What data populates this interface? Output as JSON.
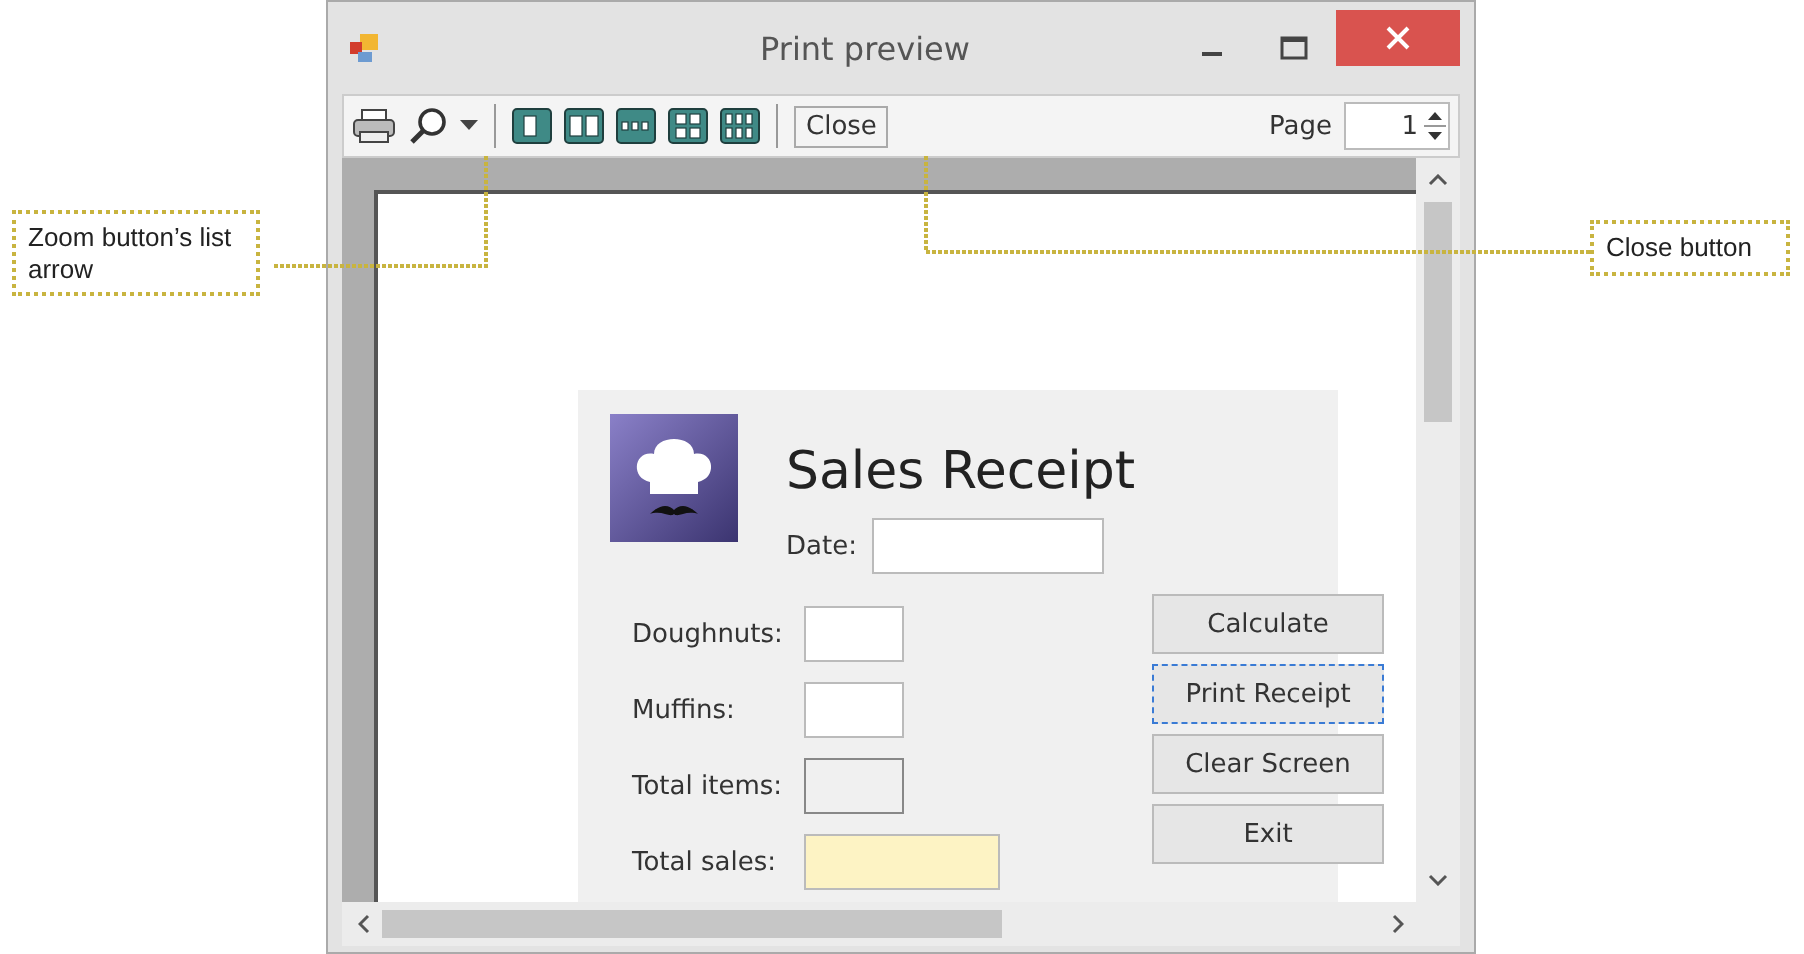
{
  "window": {
    "title": "Print preview"
  },
  "toolbar": {
    "tools": [
      {
        "kind": "print"
      },
      {
        "kind": "zoom"
      },
      {
        "kind": "dropdown"
      },
      {
        "kind": "separator"
      },
      {
        "kind": "one-page"
      },
      {
        "kind": "two-pages"
      },
      {
        "kind": "three-pages"
      },
      {
        "kind": "four-pages"
      },
      {
        "kind": "six-pages"
      },
      {
        "kind": "separator"
      }
    ],
    "close_button": "Close",
    "page_label": "Page",
    "page_value": "1"
  },
  "form": {
    "title": "Sales Receipt",
    "date_label": "Date:",
    "fields": [
      {
        "label": "Doughnuts:",
        "kind": "input"
      },
      {
        "label": "Muffins:",
        "kind": "input"
      },
      {
        "label": "Total items:",
        "kind": "output"
      },
      {
        "label": "Total sales:",
        "kind": "highlight"
      }
    ],
    "buttons": [
      {
        "label": "Calculate",
        "focused": false
      },
      {
        "label": "Print Receipt",
        "focused": true
      },
      {
        "label": "Clear Screen",
        "focused": false
      },
      {
        "label": "Exit",
        "focused": false
      }
    ]
  },
  "callouts": [
    {
      "text": "Zoom button’s list arrow",
      "kind": "left"
    },
    {
      "text": "Close button",
      "kind": "right"
    }
  ]
}
